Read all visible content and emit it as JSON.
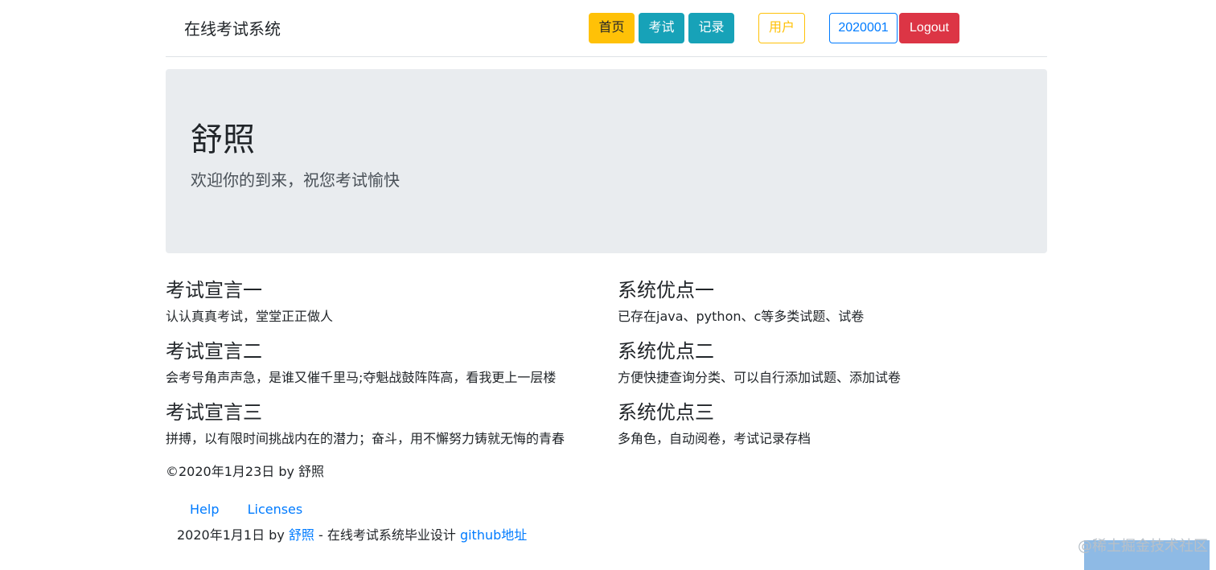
{
  "header": {
    "brand": "在线考试系统",
    "nav": {
      "home": "首页",
      "exam": "考试",
      "records": "记录",
      "user": "用户",
      "account": "2020001",
      "logout": "Logout"
    }
  },
  "jumbotron": {
    "title": "舒照",
    "lead": "欢迎你的到来，祝您考试愉快"
  },
  "features": {
    "left": [
      {
        "heading": "考试宣言一",
        "text": "认认真真考试，堂堂正正做人"
      },
      {
        "heading": "考试宣言二",
        "text": "会考号角声声急，是谁又催千里马;夺魁战鼓阵阵高，看我更上一层楼"
      },
      {
        "heading": "考试宣言三",
        "text": "拼搏，以有限时间挑战内在的潜力；奋斗，用不懈努力铸就无悔的青春"
      }
    ],
    "right": [
      {
        "heading": "系统优点一",
        "text": "已存在java、python、c等多类试题、试卷"
      },
      {
        "heading": "系统优点二",
        "text": "方便快捷查询分类、可以自行添加试题、添加试卷"
      },
      {
        "heading": "系统优点三",
        "text": "多角色，自动阅卷，考试记录存档"
      }
    ]
  },
  "copyright": "©2020年1月23日 by 舒照",
  "footer": {
    "links": {
      "help": "Help",
      "licenses": "Licenses"
    },
    "note_prefix": "2020年1月1日 by ",
    "author_link": "舒照",
    "note_middle": " - 在线考试系统毕业设计 ",
    "github_link": "github地址"
  },
  "watermark": "@稀土掘金技术社区",
  "colors": {
    "warning": "#ffc107",
    "info": "#17a2b8",
    "primary": "#007bff",
    "danger": "#dc3545",
    "jumbotron_bg": "#e9ecef"
  }
}
